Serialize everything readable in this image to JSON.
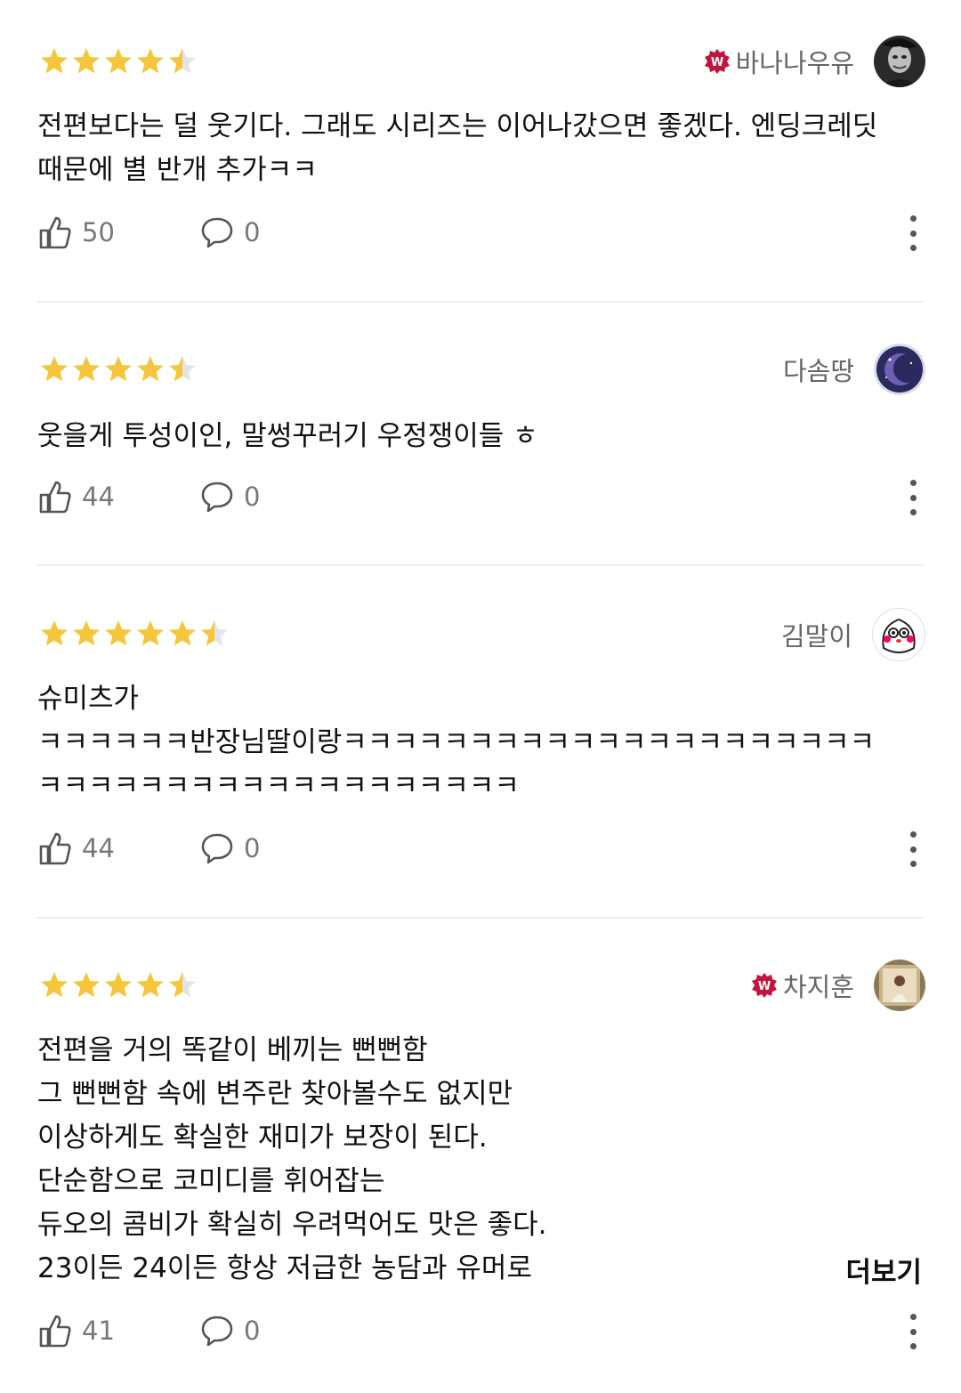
{
  "colors": {
    "star": "#f5c63c",
    "star_empty": "#e4e4e4",
    "badge": "#c4133c"
  },
  "reviews": [
    {
      "username": "바나나우유",
      "verified_badge": "W",
      "rating": 4.5,
      "text": "전편보다는 덜 웃기다. 그래도 시리즈는 이어나갔으면 좋겠다. 엔딩크레딧\n때문에 별 반개 추가ㅋㅋ",
      "likes": "50",
      "comments": "0"
    },
    {
      "username": "다솜땅",
      "rating": 4.5,
      "text": "웃을게 투성이인, 말썽꾸러기 우정쟁이들 ㅎ",
      "likes": "44",
      "comments": "0"
    },
    {
      "username": "김말이",
      "rating": 5.5,
      "text": "슈미츠가\nㅋㅋㅋㅋㅋㅋ반장님딸이랑ㅋㅋㅋㅋㅋㅋㅋㅋㅋㅋㅋㅋㅋㅋㅋㅋㅋㅋㅋㅋㅋ\nㅋㅋㅋㅋㅋㅋㅋㅋㅋㅋㅋㅋㅋㅋㅋㅋㅋㅋㅋ",
      "likes": "44",
      "comments": "0"
    },
    {
      "username": "차지훈",
      "verified_badge": "W",
      "rating": 4.5,
      "text": "전편을 거의 똑같이 베끼는 뻔뻔함\n그 뻔뻔함 속에 변주란 찾아볼수도 없지만\n이상하게도 확실한 재미가 보장이 된다.\n단순함으로 코미디를 휘어잡는\n듀오의 콤비가 확실히 우려먹어도 맛은 좋다.\n23이든 24이든 항상 저급한 농담과 유머로",
      "more_label": "더보기",
      "likes": "41",
      "comments": "0"
    }
  ]
}
